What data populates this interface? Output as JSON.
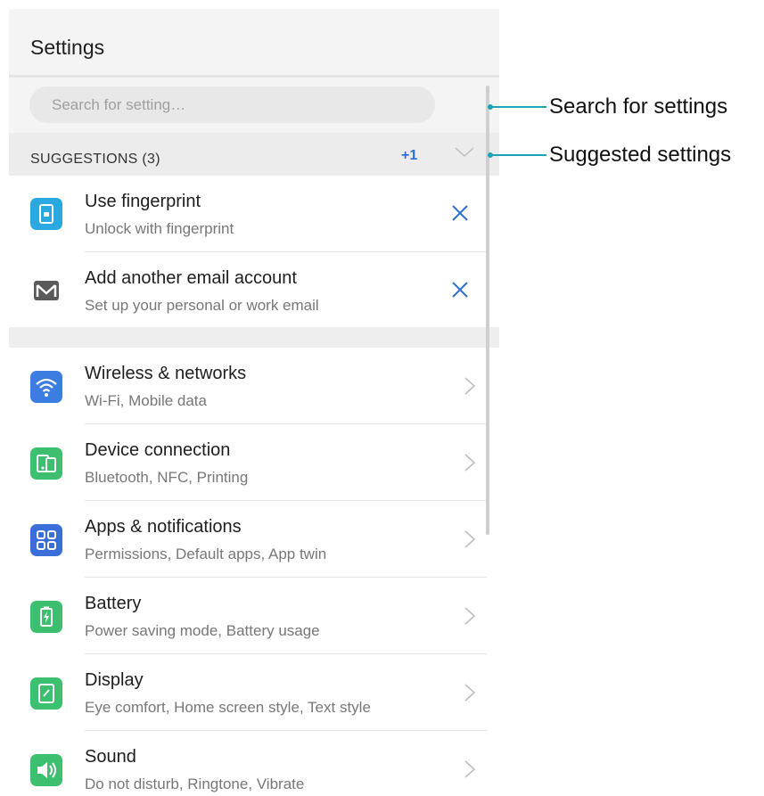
{
  "header": {
    "title": "Settings"
  },
  "search": {
    "placeholder": "Search for setting…"
  },
  "suggestions": {
    "title": "SUGGESTIONS (3)",
    "count": "+1",
    "items": [
      {
        "title": "Use fingerprint",
        "subtitle": "Unlock with fingerprint",
        "icon": "fingerprint-lock-icon",
        "color": "#29a9e0"
      },
      {
        "title": "Add another email account",
        "subtitle": "Set up your personal or work email",
        "icon": "email-icon",
        "color": "#555555"
      }
    ]
  },
  "settings": [
    {
      "title": "Wireless & networks",
      "subtitle": "Wi-Fi, Mobile data",
      "icon": "wifi-icon",
      "color": "#3b7de0"
    },
    {
      "title": "Device connection",
      "subtitle": "Bluetooth, NFC, Printing",
      "icon": "device-connection-icon",
      "color": "#3cbf6e"
    },
    {
      "title": "Apps & notifications",
      "subtitle": "Permissions, Default apps, App twin",
      "icon": "apps-grid-icon",
      "color": "#3b6fd8"
    },
    {
      "title": "Battery",
      "subtitle": "Power saving mode, Battery usage",
      "icon": "battery-icon",
      "color": "#3cbf6e"
    },
    {
      "title": "Display",
      "subtitle": "Eye comfort, Home screen style, Text style",
      "icon": "display-icon",
      "color": "#3cbf6e"
    },
    {
      "title": "Sound",
      "subtitle": "Do not disturb, Ringtone, Vibrate",
      "icon": "speaker-icon",
      "color": "#3cbf6e"
    }
  ],
  "annotations": {
    "search": "Search for settings",
    "suggested": "Suggested settings"
  },
  "colors": {
    "accent": "#2f6fd3",
    "annotation_line": "#1aa3b5"
  }
}
